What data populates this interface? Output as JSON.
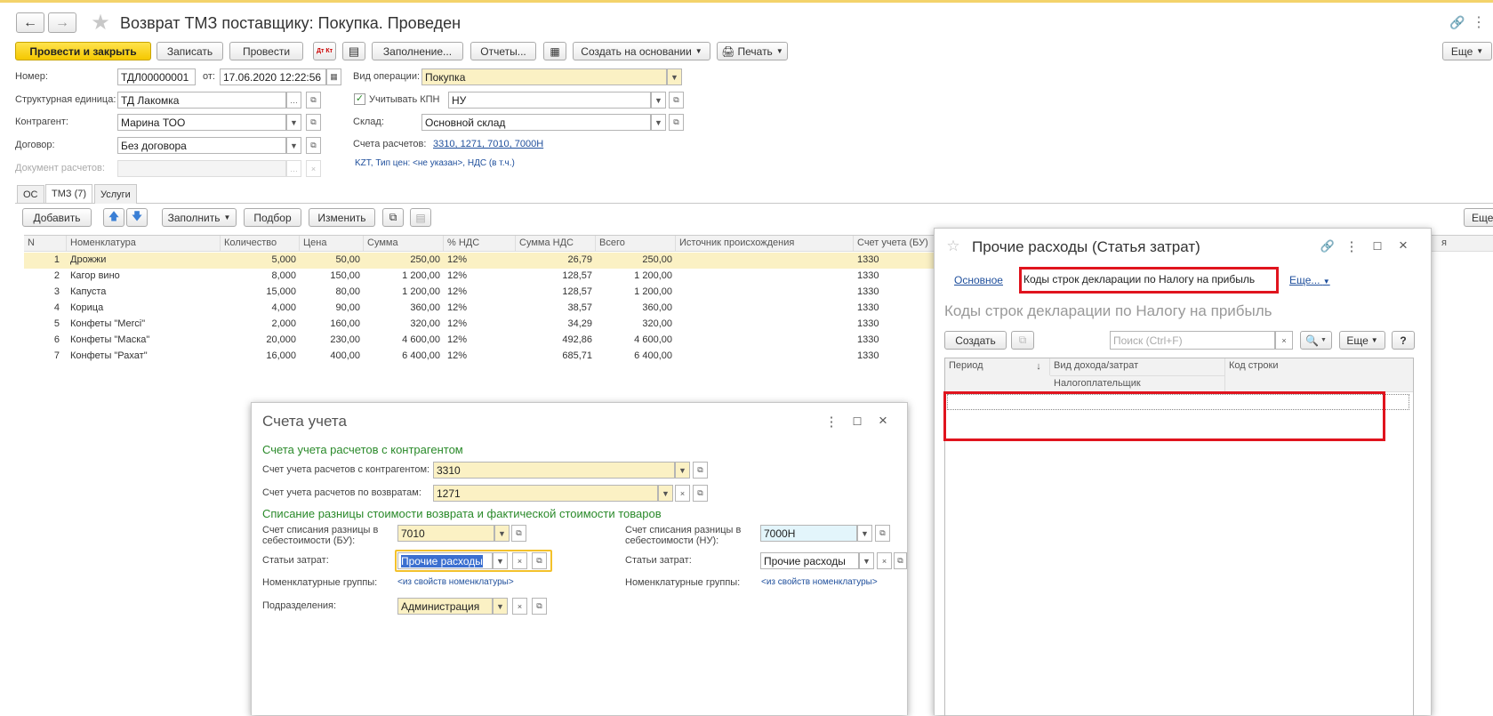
{
  "window": {
    "title": "Возврат ТМЗ поставщику: Покупка. Проведен",
    "more": "Еще"
  },
  "toolbar": {
    "post_close": "Провести и закрыть",
    "save": "Записать",
    "post": "Провести",
    "dt_kt": "Дт Кт",
    "fill": "Заполнение...",
    "reports": "Отчеты...",
    "create_based": "Создать на основании",
    "print": "Печать",
    "more": "Еще"
  },
  "form": {
    "number_label": "Номер:",
    "number": "ТДЛ00000001",
    "from_label": "от:",
    "date": "17.06.2020 12:22:56",
    "op_label": "Вид операции:",
    "op": "Покупка",
    "unit_label": "Структурная единица:",
    "unit": "ТД Лакомка",
    "kpn_label": "Учитывать КПН",
    "kpn": "НУ",
    "contractor_label": "Контрагент:",
    "contractor": "Марина ТОО",
    "warehouse_label": "Склад:",
    "warehouse": "Основной склад",
    "contract_label": "Договор:",
    "contract": "Без договора",
    "accounts_label": "Счета расчетов:",
    "accounts": "3310, 1271, 7010, 7000Н",
    "settlement_doc_label": "Документ расчетов:",
    "currency_info": "KZT, Тип цен: <не указан>, НДС (в т.ч.)"
  },
  "tabs": [
    "ОС",
    "ТМЗ (7)",
    "Услуги"
  ],
  "table_toolbar": {
    "add": "Добавить",
    "fill": "Заполнить",
    "select": "Подбор",
    "change": "Изменить",
    "more": "Еще"
  },
  "table": {
    "headers": [
      "N",
      "Номенклатура",
      "Количество",
      "Цена",
      "Сумма",
      "% НДС",
      "Сумма НДС",
      "Всего",
      "Источник происхождения",
      "Счет учета (БУ)"
    ],
    "rows": [
      [
        "1",
        "Дрожжи",
        "5,000",
        "50,00",
        "250,00",
        "12%",
        "26,79",
        "250,00",
        "",
        "1330"
      ],
      [
        "2",
        "Кагор вино",
        "8,000",
        "150,00",
        "1 200,00",
        "12%",
        "128,57",
        "1 200,00",
        "",
        "1330"
      ],
      [
        "3",
        "Капуста",
        "15,000",
        "80,00",
        "1 200,00",
        "12%",
        "128,57",
        "1 200,00",
        "",
        "1330"
      ],
      [
        "4",
        "Корица",
        "4,000",
        "90,00",
        "360,00",
        "12%",
        "38,57",
        "360,00",
        "",
        "1330"
      ],
      [
        "5",
        "Конфеты \"Merci\"",
        "2,000",
        "160,00",
        "320,00",
        "12%",
        "34,29",
        "320,00",
        "",
        "1330"
      ],
      [
        "6",
        "Конфеты \"Маска\"",
        "20,000",
        "230,00",
        "4 600,00",
        "12%",
        "492,86",
        "4 600,00",
        "",
        "1330"
      ],
      [
        "7",
        "Конфеты \"Рахат\"",
        "16,000",
        "400,00",
        "6 400,00",
        "12%",
        "685,71",
        "6 400,00",
        "",
        "1330"
      ]
    ],
    "cut_header": "я"
  },
  "accounts_dialog": {
    "title": "Счета учета",
    "section1": "Счета учета расчетов с контрагентом",
    "acc_contractor_label": "Счет учета расчетов с контрагентом:",
    "acc_contractor": "3310",
    "acc_returns_label": "Счет учета расчетов по возвратам:",
    "acc_returns": "1271",
    "section2": "Списание разницы стоимости возврата и фактической стоимости товаров",
    "writeoff_bu_label": "Счет списания разницы в себестоимости (БУ):",
    "writeoff_bu": "7010",
    "writeoff_nu_label": "Счет списания разницы в себестоимости (НУ):",
    "writeoff_nu": "7000Н",
    "cost_items_label": "Статьи затрат:",
    "cost_items_bu": "Прочие расходы",
    "cost_items_nu": "Прочие расходы",
    "nom_groups_label": "Номенклатурные группы:",
    "nom_groups_bu": "<из свойств номенклатуры>",
    "nom_groups_nu": "<из свойств номенклатуры>",
    "divisions_label": "Подразделения:",
    "divisions": "Администрация"
  },
  "expense_window": {
    "title": "Прочие расходы (Статья затрат)",
    "tab_main": "Основное",
    "tab_codes": "Коды строк декларации по Налогу на прибыль",
    "tab_more": "Еще...",
    "heading": "Коды строк декларации по Налогу на прибыль",
    "create": "Создать",
    "search_placeholder": "Поиск (Ctrl+F)",
    "more": "Еще",
    "help": "?",
    "col_period": "Период",
    "col_type": "Вид дохода/затрат",
    "col_code": "Код строки",
    "col_taxpayer": "Налогоплательщик"
  }
}
